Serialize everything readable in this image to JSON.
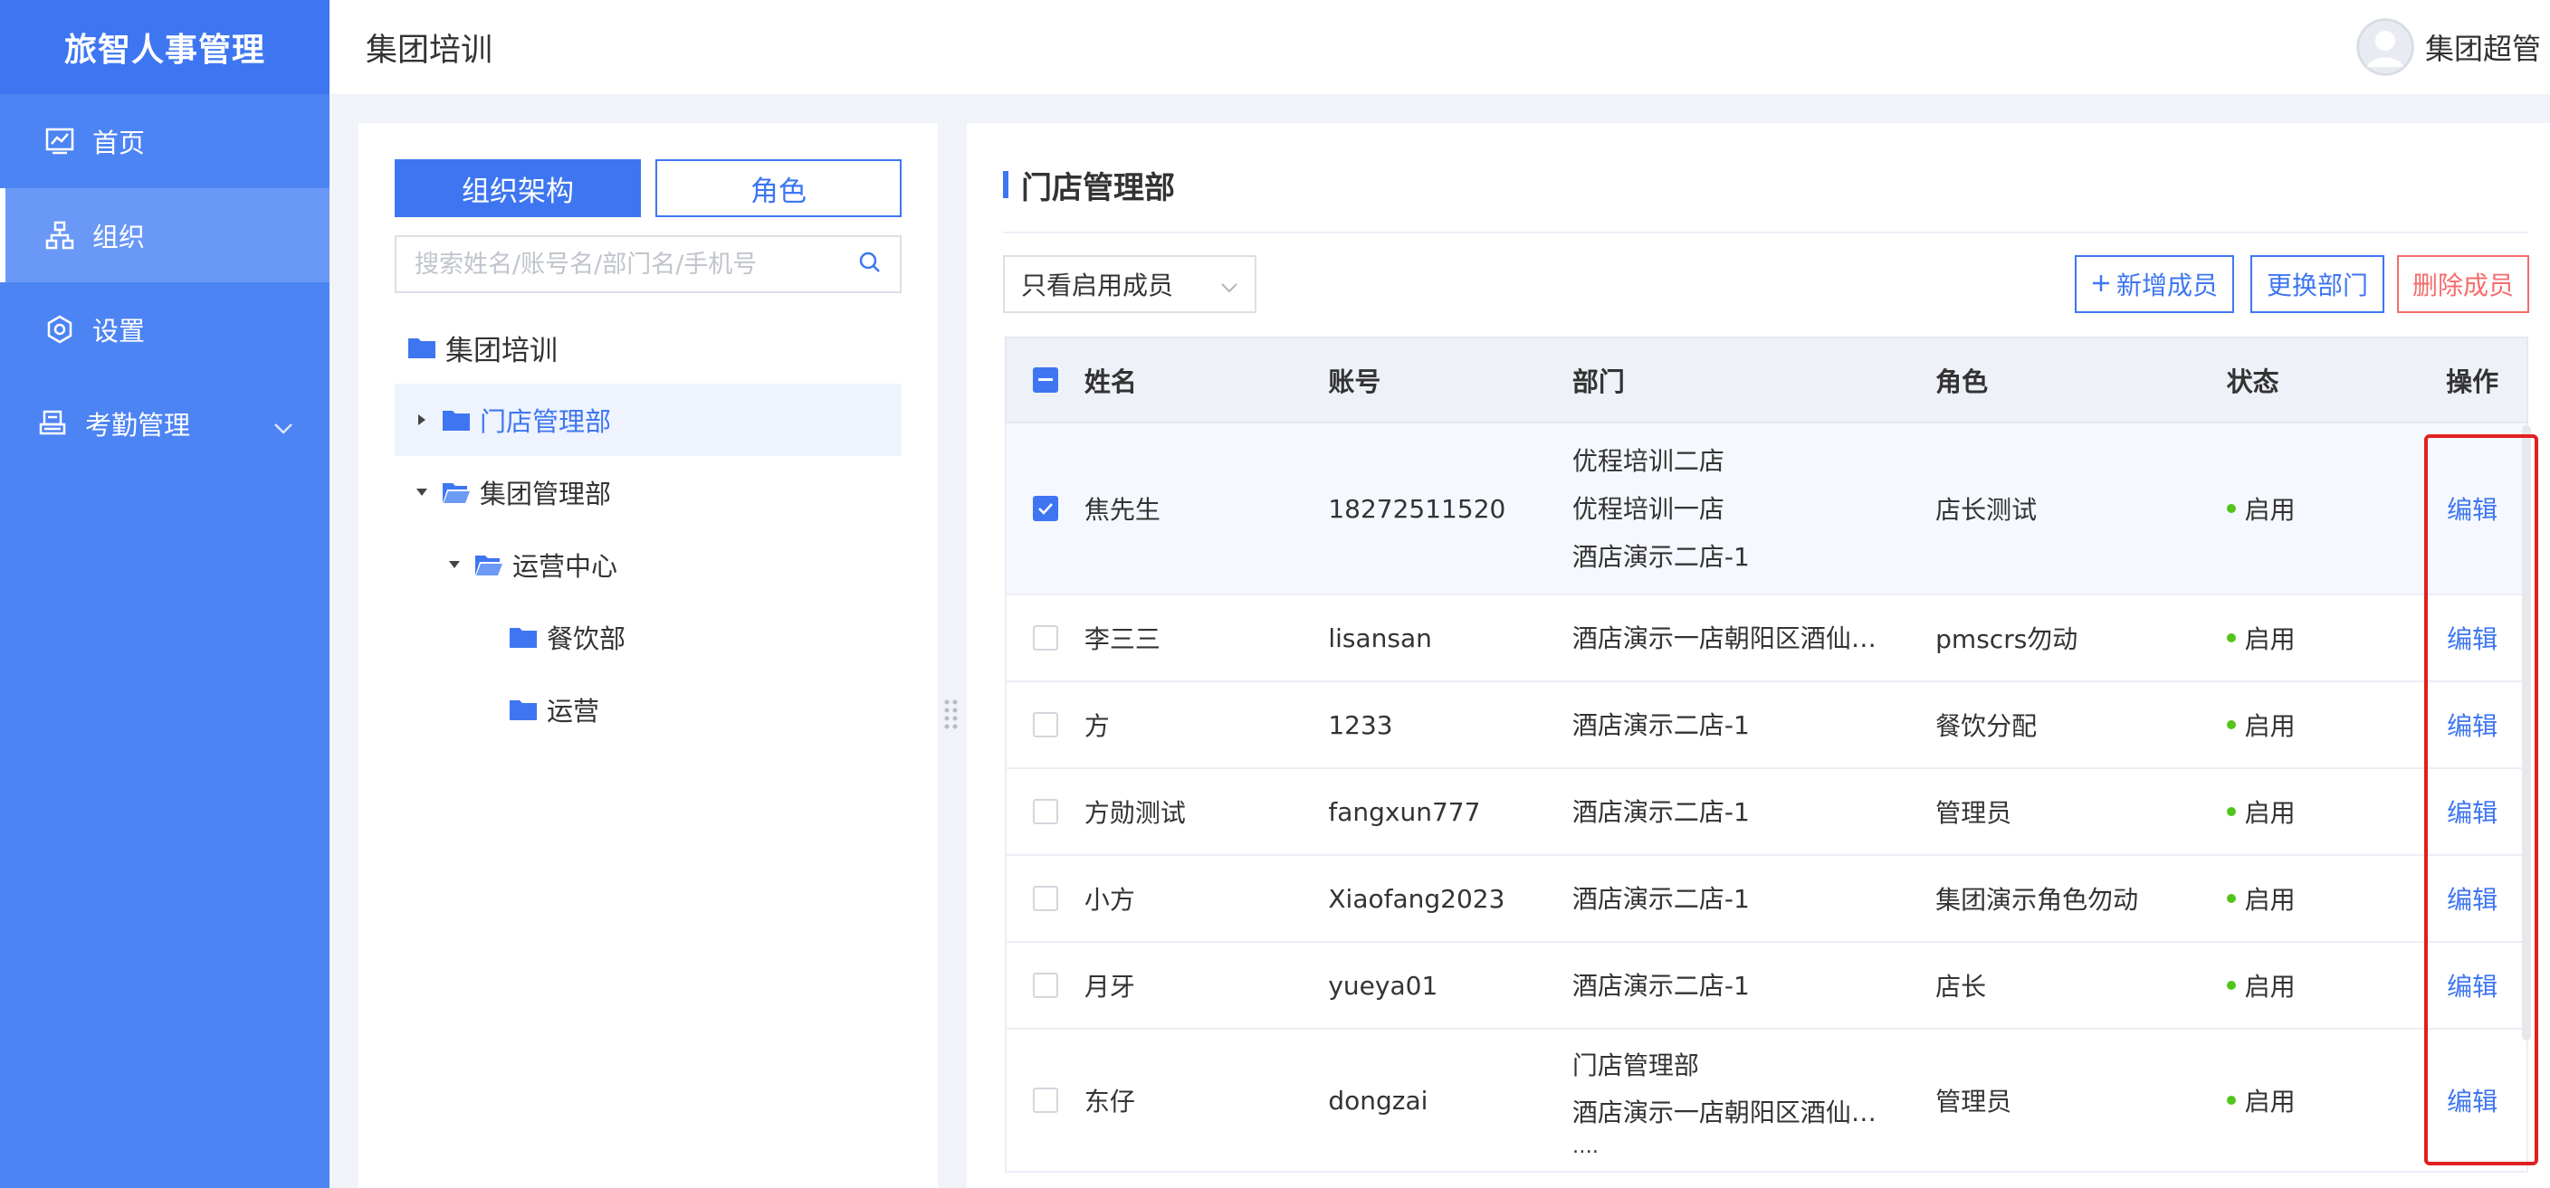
{
  "sidebar": {
    "brand": "旅智人事管理",
    "items": [
      {
        "label": "首页",
        "icon": "chart-icon"
      },
      {
        "label": "组织",
        "icon": "org-icon",
        "active": true
      },
      {
        "label": "设置",
        "icon": "settings-icon"
      },
      {
        "label": "考勤管理",
        "icon": "attendance-icon",
        "expandable": true
      }
    ]
  },
  "header": {
    "title": "集团培训",
    "user": "集团超管"
  },
  "tree": {
    "tabs": [
      "组织架构",
      "角色"
    ],
    "search_placeholder": "搜索姓名/账号名/部门名/手机号",
    "nodes": [
      {
        "label": "集团培训",
        "level": 0
      },
      {
        "label": "门店管理部",
        "level": 1,
        "selected": true,
        "caret": "right"
      },
      {
        "label": "集团管理部",
        "level": 1,
        "caret": "down"
      },
      {
        "label": "运营中心",
        "level": 2,
        "caret": "down"
      },
      {
        "label": "餐饮部",
        "level": 3
      },
      {
        "label": "运营",
        "level": 3
      }
    ]
  },
  "main": {
    "title": "门店管理部",
    "filter": "只看启用成员",
    "buttons": {
      "add": "新增成员",
      "change": "更换部门",
      "delete": "删除成员"
    },
    "columns": [
      "姓名",
      "账号",
      "部门",
      "角色",
      "状态",
      "操作"
    ],
    "rows": [
      {
        "name": "焦先生",
        "account": "18272511520",
        "dept": [
          "优程培训二店",
          "优程培训一店",
          "酒店演示二店-1"
        ],
        "role": "店长测试",
        "status": "启用",
        "op": "编辑",
        "checked": true
      },
      {
        "name": "李三三",
        "account": "lisansan",
        "dept": [
          "酒店演示一店朝阳区酒仙…"
        ],
        "role": "pmscrs勿动",
        "status": "启用",
        "op": "编辑"
      },
      {
        "name": "方",
        "account": "1233",
        "dept": [
          "酒店演示二店-1"
        ],
        "role": "餐饮分配",
        "status": "启用",
        "op": "编辑"
      },
      {
        "name": "方勋测试",
        "account": "fangxun777",
        "dept": [
          "酒店演示二店-1"
        ],
        "role": "管理员",
        "status": "启用",
        "op": "编辑"
      },
      {
        "name": "小方",
        "account": "Xiaofang2023",
        "dept": [
          "酒店演示二店-1"
        ],
        "role": "集团演示角色勿动",
        "status": "启用",
        "op": "编辑"
      },
      {
        "name": "月牙",
        "account": "yueya01",
        "dept": [
          "酒店演示二店-1"
        ],
        "role": "店长",
        "status": "启用",
        "op": "编辑"
      },
      {
        "name": "东仔",
        "account": "dongzai",
        "dept": [
          "门店管理部",
          "酒店演示一店朝阳区酒仙…",
          "…."
        ],
        "role": "管理员",
        "status": "启用",
        "op": "编辑"
      }
    ]
  }
}
